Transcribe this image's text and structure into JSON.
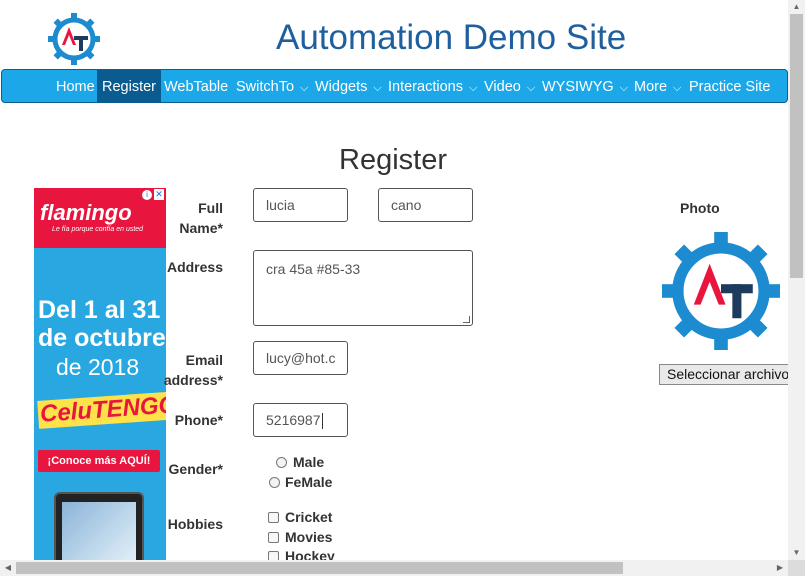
{
  "header": {
    "title": "Automation Demo Site"
  },
  "nav": [
    {
      "label": "Home",
      "dropdown": false
    },
    {
      "label": "Register",
      "dropdown": false,
      "active": true
    },
    {
      "label": "WebTable",
      "dropdown": false
    },
    {
      "label": "SwitchTo",
      "dropdown": true
    },
    {
      "label": "Widgets",
      "dropdown": true
    },
    {
      "label": "Interactions",
      "dropdown": true
    },
    {
      "label": "Video",
      "dropdown": true
    },
    {
      "label": "WYSIWYG",
      "dropdown": true
    },
    {
      "label": "More",
      "dropdown": true
    },
    {
      "label": "Practice Site",
      "dropdown": false
    }
  ],
  "chevron": "⌵",
  "page": {
    "heading": "Register"
  },
  "ad": {
    "brand": "flamingo",
    "brand_accent": "°",
    "tagline": "Le fía porque confía en usted",
    "line1": "Del 1 al 31",
    "line2": "de octubre",
    "line3": "de 2018",
    "promo": "CeluTENGO",
    "cta": "¡Conoce más AQUÍ!",
    "info_icon": "i",
    "close_icon": "✕"
  },
  "form": {
    "fullname_label": "Full Name*",
    "first_name": "lucia",
    "last_name": "cano",
    "address_label": "Address",
    "address": "cra 45a #85-33",
    "email_label": "Email address*",
    "email": "lucy@hot.c",
    "phone_label": "Phone*",
    "phone": "5216987",
    "gender_label": "Gender*",
    "gender_options": [
      "Male",
      "FeMale"
    ],
    "hobbies_label": "Hobbies",
    "hobbies": [
      "Cricket",
      "Movies",
      "Hockey"
    ]
  },
  "photo": {
    "label": "Photo",
    "button": "Seleccionar archivo"
  },
  "colors": {
    "brand_blue": "#1f5f9e",
    "nav_bg": "#1ca8e8",
    "nav_active": "#0a5b8f",
    "logo_red": "#e8153f",
    "logo_navy": "#1d3b5c"
  }
}
